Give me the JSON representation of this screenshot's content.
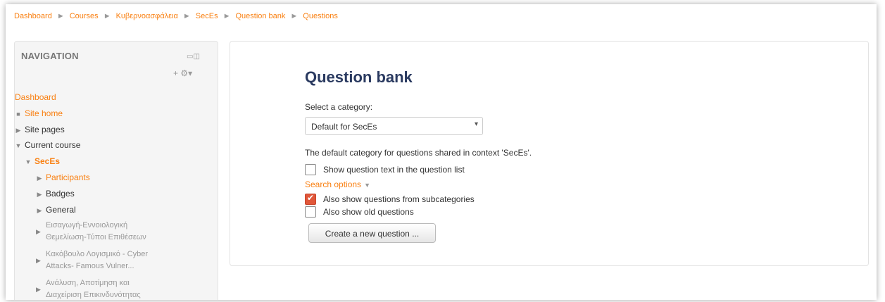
{
  "breadcrumb": {
    "items": [
      "Dashboard",
      "Courses",
      "Κυβερνοασφάλεια",
      "SecEs",
      "Question bank",
      "Questions"
    ],
    "separator": "►"
  },
  "nav": {
    "title": "NAVIGATION",
    "dock_icons": "▭◫",
    "actions": "+ ⚙▾",
    "items": [
      {
        "label": "Dashboard",
        "marker": ""
      },
      {
        "label": "Site home",
        "marker": "■"
      },
      {
        "label": "Site pages",
        "marker": "▶"
      },
      {
        "label": "Current course",
        "marker": "▼"
      },
      {
        "label": "SecEs",
        "marker": "▼"
      },
      {
        "label": "Participants",
        "marker": "▶"
      },
      {
        "label": "Badges",
        "marker": "▶"
      },
      {
        "label": "General",
        "marker": "▶"
      },
      {
        "label_line1": "Εισαγωγή-Εννοιολογική",
        "label_line2": "Θεμελίωση-Τύποι Επιθέσεων",
        "marker": "▶"
      },
      {
        "label_line1": "Κακόβουλο Λογισμικό - Cyber",
        "label_line2": "Attacks- Famous Vulner...",
        "marker": "▶"
      },
      {
        "label_line1": "Ανάλυση, Αποτίμηση και",
        "label_line2": "Διαχείριση Επικινδυνότητας",
        "marker": "▶"
      }
    ]
  },
  "main": {
    "title": "Question bank",
    "category_label": "Select a category:",
    "category_value": "Default for SecEs",
    "select_arrow": "▾",
    "category_info": "The default category for questions shared in context 'SecEs'.",
    "show_text_label": "Show question text in the question list",
    "show_text_checked": false,
    "search_options_label": "Search options",
    "search_caret": "▼",
    "subcat_label": "Also show questions from subcategories",
    "subcat_checked": true,
    "old_label": "Also show old questions",
    "old_checked": false,
    "tick": "✔",
    "create_button": "Create a new question ..."
  },
  "colors": {
    "link": "#f98012",
    "title": "#2a3a60",
    "checked": "#e0573a"
  }
}
